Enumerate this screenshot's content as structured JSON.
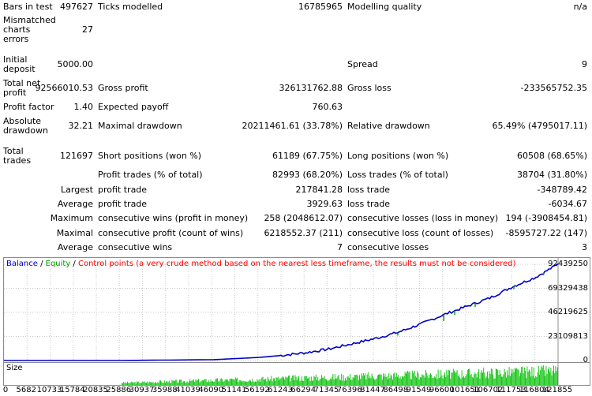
{
  "stats": {
    "bars_in_test": {
      "label": "Bars in test",
      "value": "497627"
    },
    "ticks_modelled": {
      "label": "Ticks modelled",
      "value": "16785965"
    },
    "modelling_quality": {
      "label": "Modelling quality",
      "value": "n/a"
    },
    "mismatched": {
      "label": "Mismatched charts errors",
      "value": "27"
    },
    "initial_deposit": {
      "label": "Initial deposit",
      "value": "5000.00"
    },
    "spread": {
      "label": "Spread",
      "value": "9"
    },
    "total_net_profit": {
      "label": "Total net profit",
      "value": "92566010.53"
    },
    "gross_profit": {
      "label": "Gross profit",
      "value": "326131762.88"
    },
    "gross_loss": {
      "label": "Gross loss",
      "value": "-233565752.35"
    },
    "profit_factor": {
      "label": "Profit factor",
      "value": "1.40"
    },
    "expected_payoff": {
      "label": "Expected payoff",
      "value": "760.63"
    },
    "absolute_drawdown": {
      "label": "Absolute drawdown",
      "value": "32.21"
    },
    "maximal_drawdown": {
      "label": "Maximal drawdown",
      "value": "20211461.61 (33.78%)"
    },
    "relative_drawdown": {
      "label": "Relative drawdown",
      "value": "65.49% (4795017.11)"
    },
    "total_trades": {
      "label": "Total trades",
      "value": "121697"
    },
    "short_positions": {
      "label": "Short positions (won %)",
      "value": "61189 (67.75%)"
    },
    "long_positions": {
      "label": "Long positions (won %)",
      "value": "60508 (68.65%)"
    },
    "profit_trades": {
      "label": "Profit trades (% of total)",
      "value": "82993 (68.20%)"
    },
    "loss_trades": {
      "label": "Loss trades (% of total)",
      "value": "38704 (31.80%)"
    },
    "largest_label": "Largest",
    "largest_profit": {
      "label": "profit trade",
      "value": "217841.28"
    },
    "largest_loss": {
      "label": "loss trade",
      "value": "-348789.42"
    },
    "average_label": "Average",
    "average_profit": {
      "label": "profit trade",
      "value": "3929.63"
    },
    "average_loss": {
      "label": "loss trade",
      "value": "-6034.67"
    },
    "maximum_label": "Maximum",
    "max_cons_wins": {
      "label": "consecutive wins (profit in money)",
      "value": "258 (2048612.07)"
    },
    "max_cons_losses": {
      "label": "consecutive losses (loss in money)",
      "value": "194 (-3908454.81)"
    },
    "maximal_label": "Maximal",
    "maximal_cons_profit": {
      "label": "consecutive profit (count of wins)",
      "value": "6218552.37 (211)"
    },
    "maximal_cons_loss": {
      "label": "consecutive loss (count of losses)",
      "value": "-8595727.22 (147)"
    },
    "average2_label": "Average",
    "avg_cons_wins": {
      "label": "consecutive wins",
      "value": "7"
    },
    "avg_cons_losses": {
      "label": "consecutive losses",
      "value": "3"
    }
  },
  "legend": {
    "balance": "Balance",
    "sep1": " / ",
    "equity": "Equity",
    "sep2": " / ",
    "control": "Control points (a very crude method based on the nearest less timeframe, the results must not be considered)"
  },
  "size_label": "Size",
  "colors": {
    "balance": "#0000c8",
    "equity": "#00a000",
    "control": "#ff0000",
    "grid": "#c8c8c8",
    "size_bars": "#00c000"
  },
  "chart_data": {
    "type": "line",
    "x_ticks": [
      "0",
      "5682",
      "10733",
      "15784",
      "20835",
      "25886",
      "30937",
      "35988",
      "41039",
      "46090",
      "51141",
      "56192",
      "61243",
      "66294",
      "71345",
      "76396",
      "81447",
      "86498",
      "91549",
      "96600",
      "101651",
      "106702",
      "111753",
      "116804",
      "121855"
    ],
    "y_ticks": [
      "92439250",
      "69329438",
      "46219625",
      "23109813",
      "0"
    ],
    "ylim": [
      0,
      92439250
    ],
    "xlim": [
      0,
      121697
    ],
    "series": [
      {
        "name": "Balance",
        "x": [
          0,
          25886,
          46090,
          56192,
          61243,
          66294,
          71345,
          76396,
          81447,
          86498,
          91549,
          96600,
          101651,
          106702,
          111753,
          116804,
          121697
        ],
        "y": [
          5000,
          20000,
          800000,
          3000000,
          5000000,
          7500000,
          11000000,
          16000000,
          21000000,
          27000000,
          35000000,
          44000000,
          52000000,
          60000000,
          71000000,
          80000000,
          92566010
        ]
      }
    ],
    "size_range": {
      "start": 25886,
      "end": 121697
    }
  }
}
